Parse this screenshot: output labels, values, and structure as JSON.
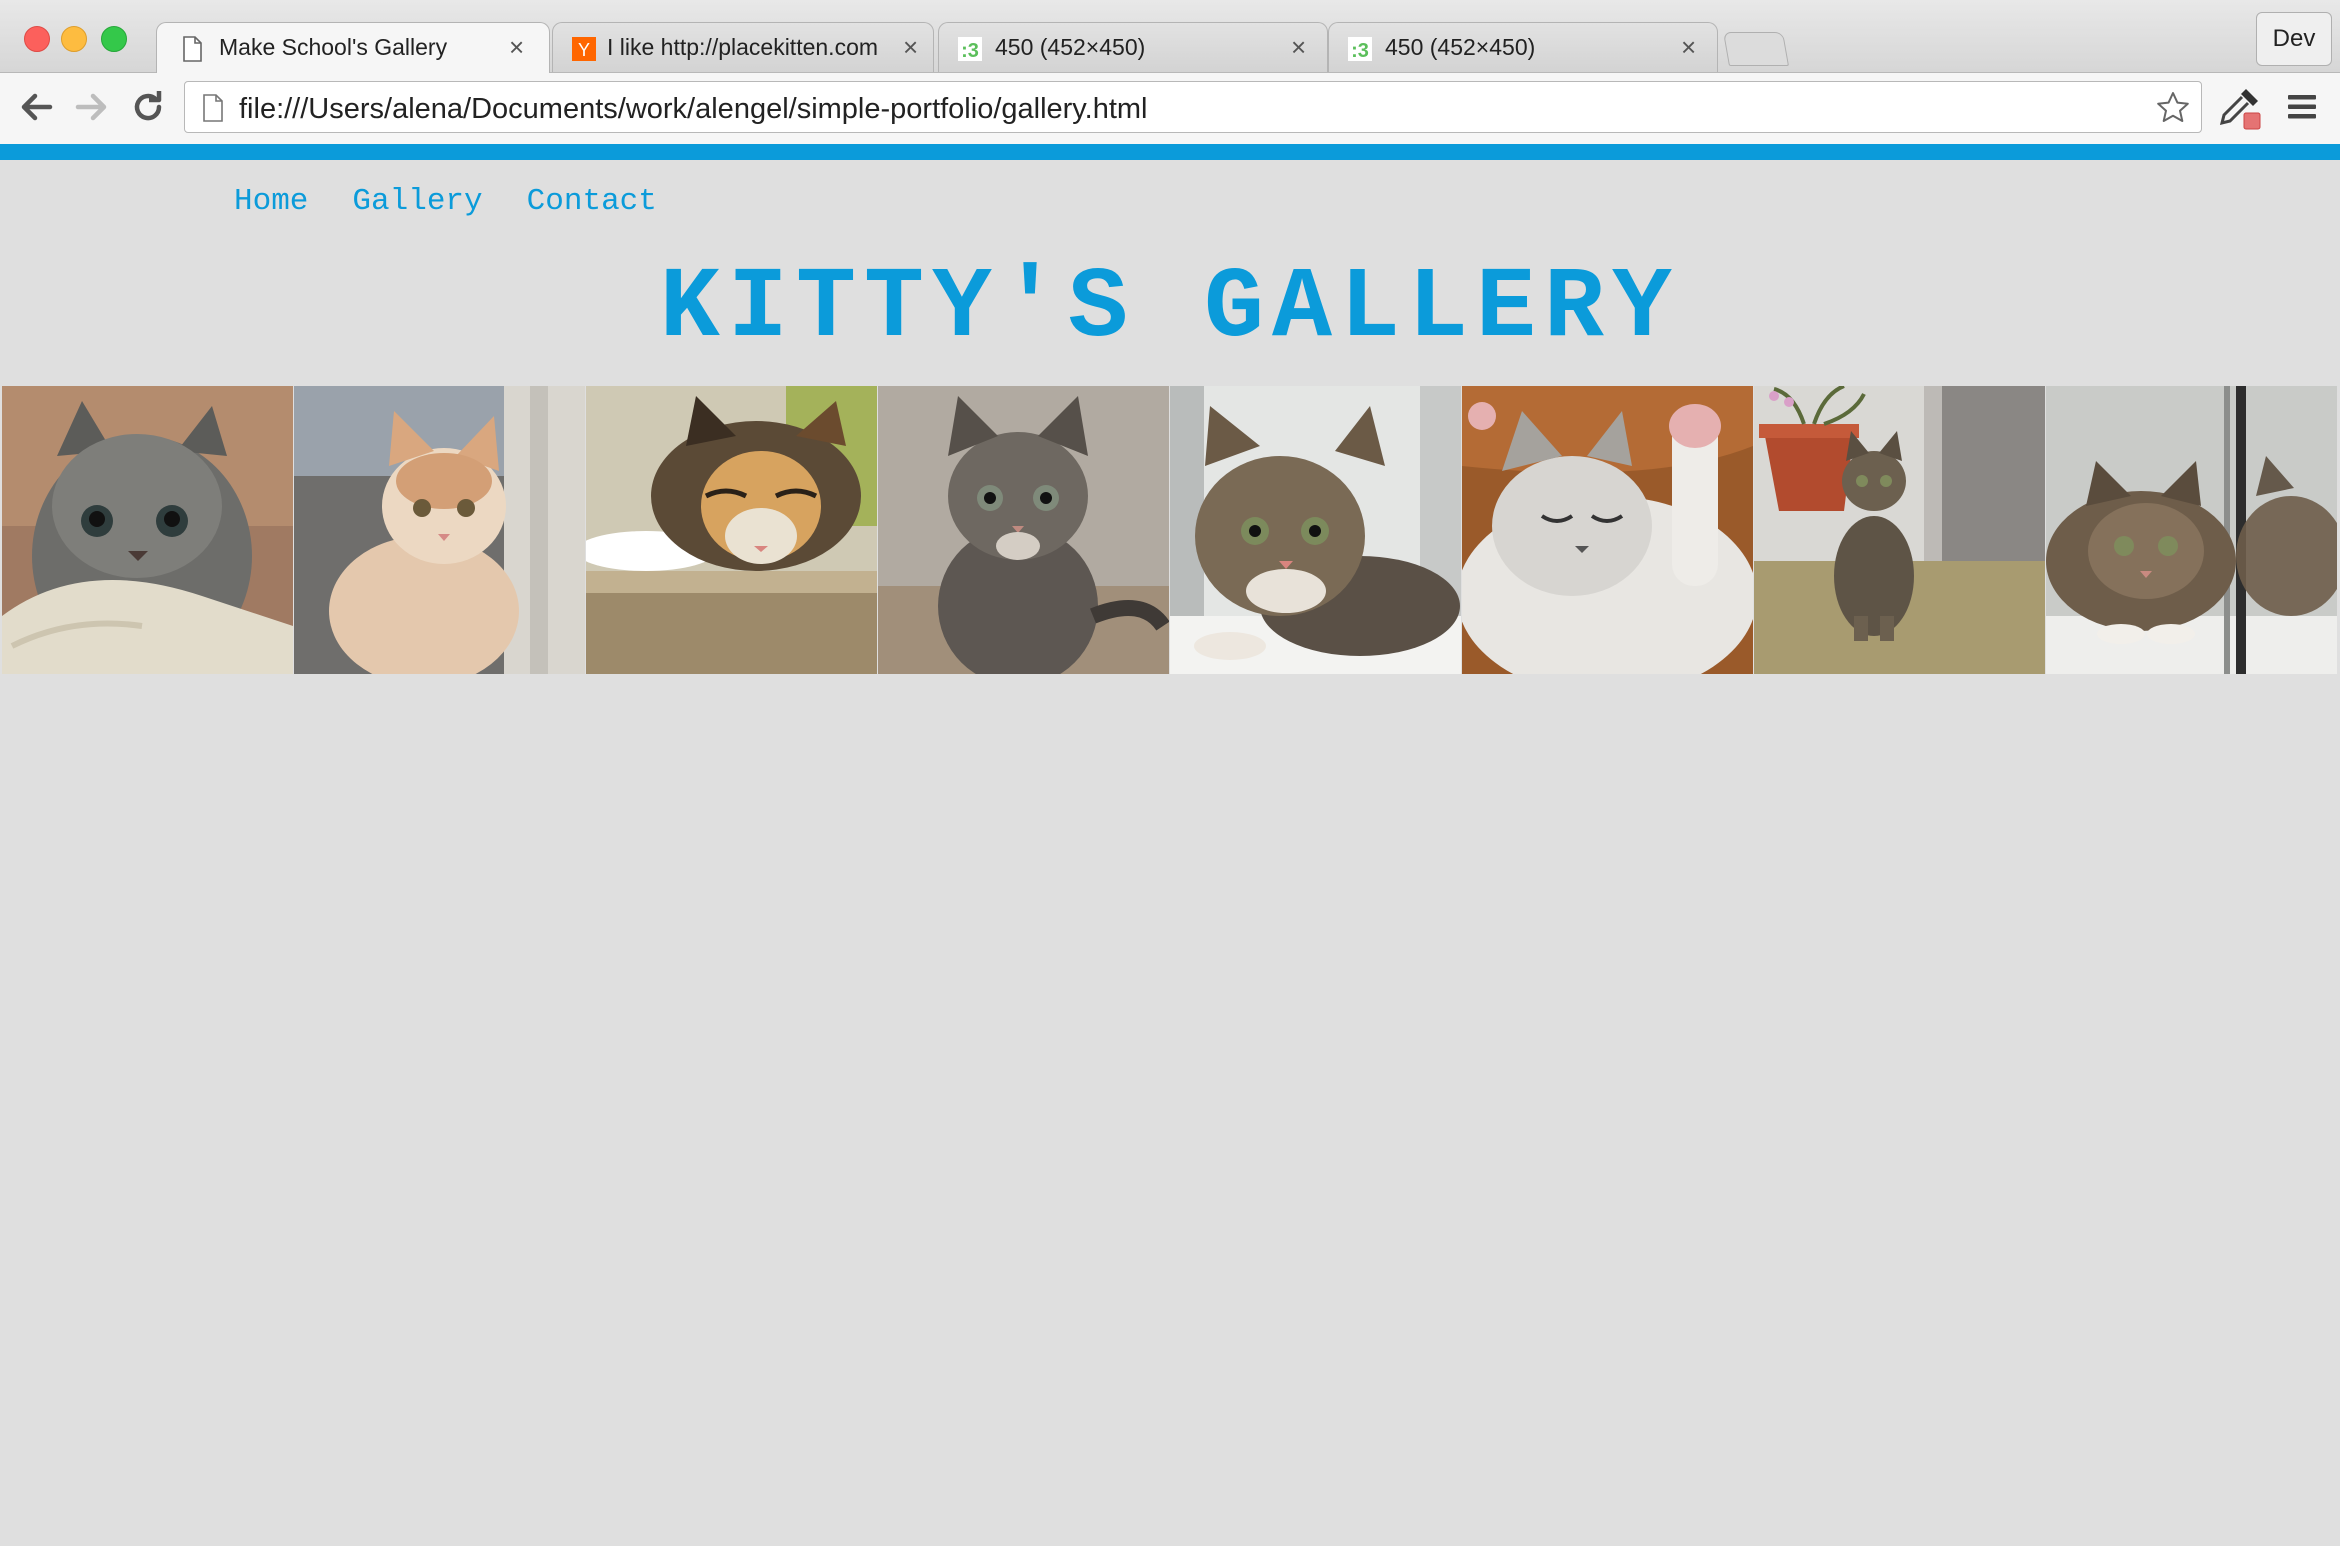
{
  "browser": {
    "tabs": [
      {
        "title": "Make School's Gallery",
        "favicon": "document-icon",
        "active": true
      },
      {
        "title": "I like http://placekitten.com",
        "favicon": "y-combinator-icon",
        "active": false
      },
      {
        "title": "450 (452×450)",
        "favicon": "placekitten-icon",
        "active": false
      },
      {
        "title": "450 (452×450)",
        "favicon": "placekitten-icon",
        "active": false
      }
    ],
    "profile_label": "Dev",
    "url": "file:///Users/alena/Documents/work/alengel/simple-portfolio/gallery.html"
  },
  "colors": {
    "accent": "#0b9bda",
    "page_background": "#dfdfdf"
  },
  "site": {
    "nav": [
      {
        "label": "Home"
      },
      {
        "label": "Gallery"
      },
      {
        "label": "Contact"
      }
    ],
    "title": "KITTY'S GALLERY"
  },
  "gallery": {
    "images": [
      "gray fluffy kitten on white blanket",
      "ginger and white kitten by doorway",
      "calico kitten sniffing a step",
      "gray tabby kitten sitting",
      "tabby kitten lying by window",
      "sleeping white kitten with raised paw",
      "tabby kitten by flower pot",
      "tabby kitten with reflection in glass"
    ]
  }
}
